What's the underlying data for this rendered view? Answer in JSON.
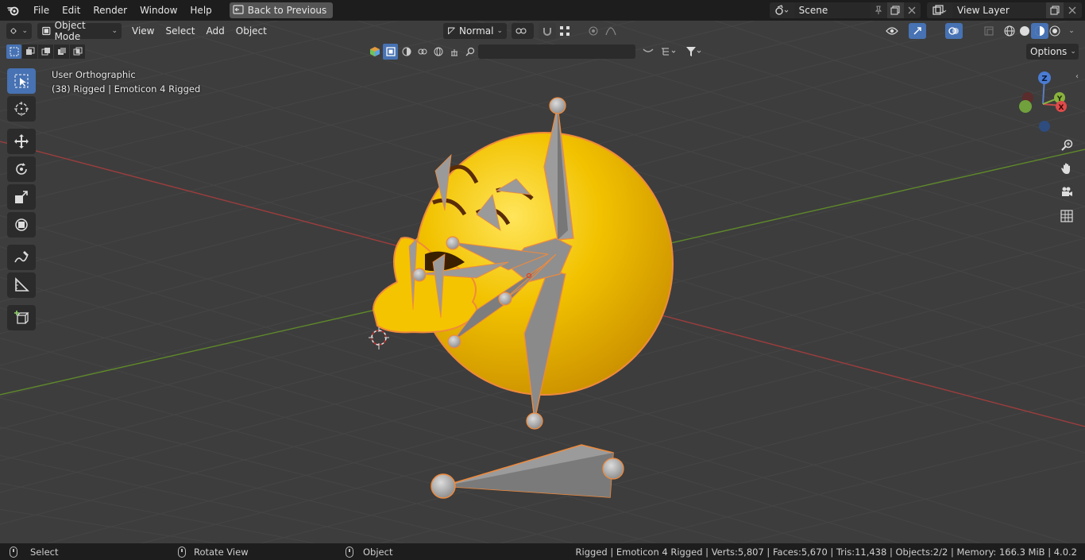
{
  "menubar": {
    "items": [
      "File",
      "Edit",
      "Render",
      "Window",
      "Help"
    ],
    "back_button": "Back to Previous",
    "scene": "Scene",
    "view_layer": "View Layer"
  },
  "header": {
    "mode": "Object Mode",
    "menus": [
      "View",
      "Select",
      "Add",
      "Object"
    ],
    "orientation": "Normal",
    "options_label": "Options"
  },
  "viewport": {
    "view_name": "User Orthographic",
    "object_info": "(38) Rigged | Emoticon 4 Rigged",
    "gizmo": {
      "z_label": "Z",
      "y_label": "Y",
      "x_label": "X"
    }
  },
  "statusbar": {
    "select": "Select",
    "rotate": "Rotate View",
    "object": "Object",
    "stats": "Rigged | Emoticon 4 Rigged | Verts:5,807 | Faces:5,670 | Tris:11,438 | Objects:2/2 | Memory: 166.3 MiB | 4.0.2"
  },
  "colors": {
    "accent": "#4772b3",
    "selection_outline": "#f08a3c",
    "emoji_yellow": "#f2c200",
    "bone_gray": "#8c8c8c",
    "axis_x": "#b84a4a",
    "axis_y": "#6b9a2f"
  }
}
